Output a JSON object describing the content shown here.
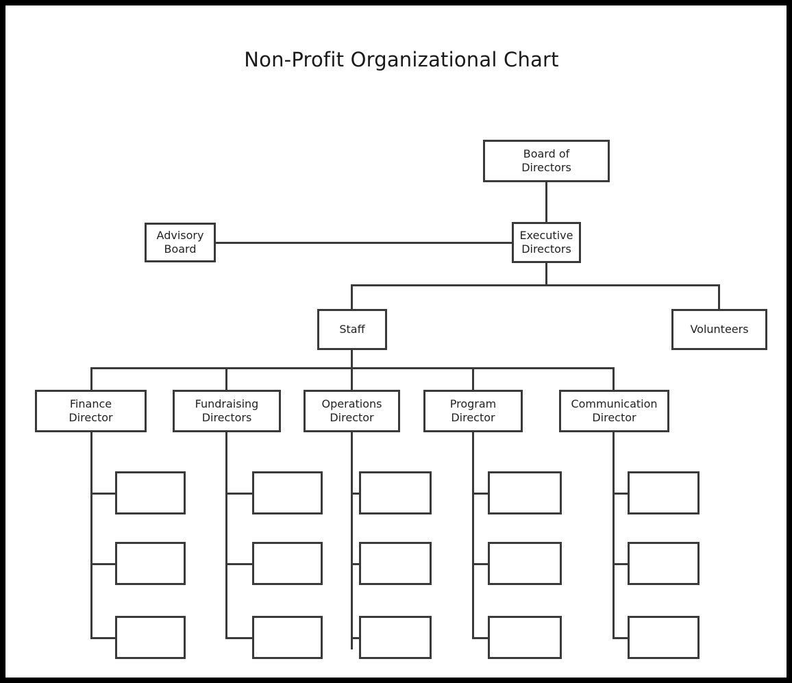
{
  "chart_data": {
    "type": "diagram",
    "diagram_type": "organizational-chart",
    "title": "Non-Profit Organizational Chart",
    "orientation": "top-down",
    "node_fill": "#ffffff",
    "node_stroke": "#3a3a3a",
    "edge_color": "#3a3a3a",
    "frame_color": "#000000",
    "background": "#ffffff",
    "nodes": [
      {
        "id": "board",
        "label": "Board of\nDirectors",
        "level": 0
      },
      {
        "id": "executive",
        "label": "Executive\nDirectors",
        "level": 1
      },
      {
        "id": "advisory",
        "label": "Advisory\nBoard",
        "level": 1
      },
      {
        "id": "staff",
        "label": "Staff",
        "level": 2
      },
      {
        "id": "volunteers",
        "label": "Volunteers",
        "level": 2
      },
      {
        "id": "finance",
        "label": "Finance\nDirector",
        "level": 3
      },
      {
        "id": "fundraising",
        "label": "Fundraising\nDirectors",
        "level": 3
      },
      {
        "id": "operations",
        "label": "Operations\nDirector",
        "level": 3
      },
      {
        "id": "program",
        "label": "Program\nDirector",
        "level": 3
      },
      {
        "id": "communication",
        "label": "Communication\nDirector",
        "level": 3
      },
      {
        "id": "finance-1",
        "label": "",
        "level": 4
      },
      {
        "id": "finance-2",
        "label": "",
        "level": 4
      },
      {
        "id": "finance-3",
        "label": "",
        "level": 4
      },
      {
        "id": "fundraising-1",
        "label": "",
        "level": 4
      },
      {
        "id": "fundraising-2",
        "label": "",
        "level": 4
      },
      {
        "id": "fundraising-3",
        "label": "",
        "level": 4
      },
      {
        "id": "operations-1",
        "label": "",
        "level": 4
      },
      {
        "id": "operations-2",
        "label": "",
        "level": 4
      },
      {
        "id": "operations-3",
        "label": "",
        "level": 4
      },
      {
        "id": "program-1",
        "label": "",
        "level": 4
      },
      {
        "id": "program-2",
        "label": "",
        "level": 4
      },
      {
        "id": "program-3",
        "label": "",
        "level": 4
      },
      {
        "id": "communication-1",
        "label": "",
        "level": 4
      },
      {
        "id": "communication-2",
        "label": "",
        "level": 4
      },
      {
        "id": "communication-3",
        "label": "",
        "level": 4
      }
    ],
    "edges": [
      {
        "from": "board",
        "to": "executive"
      },
      {
        "from": "advisory",
        "to": "executive"
      },
      {
        "from": "executive",
        "to": "staff"
      },
      {
        "from": "executive",
        "to": "volunteers"
      },
      {
        "from": "staff",
        "to": "finance"
      },
      {
        "from": "staff",
        "to": "fundraising"
      },
      {
        "from": "staff",
        "to": "operations"
      },
      {
        "from": "staff",
        "to": "program"
      },
      {
        "from": "staff",
        "to": "communication"
      },
      {
        "from": "finance",
        "to": "finance-1"
      },
      {
        "from": "finance",
        "to": "finance-2"
      },
      {
        "from": "finance",
        "to": "finance-3"
      },
      {
        "from": "fundraising",
        "to": "fundraising-1"
      },
      {
        "from": "fundraising",
        "to": "fundraising-2"
      },
      {
        "from": "fundraising",
        "to": "fundraising-3"
      },
      {
        "from": "operations",
        "to": "operations-1"
      },
      {
        "from": "operations",
        "to": "operations-2"
      },
      {
        "from": "operations",
        "to": "operations-3"
      },
      {
        "from": "program",
        "to": "program-1"
      },
      {
        "from": "program",
        "to": "program-2"
      },
      {
        "from": "program",
        "to": "program-3"
      },
      {
        "from": "communication",
        "to": "communication-1"
      },
      {
        "from": "communication",
        "to": "communication-2"
      },
      {
        "from": "communication",
        "to": "communication-3"
      }
    ]
  },
  "title": "Non-Profit Organizational Chart",
  "nodes": {
    "board": "Board of\nDirectors",
    "executive": "Executive\nDirectors",
    "advisory": "Advisory\nBoard",
    "staff": "Staff",
    "volunteers": "Volunteers",
    "finance": "Finance\nDirector",
    "fundraising": "Fundraising\nDirectors",
    "operations": "Operations\nDirector",
    "program": "Program\nDirector",
    "communication": "Communication\nDirector",
    "empty": ""
  }
}
